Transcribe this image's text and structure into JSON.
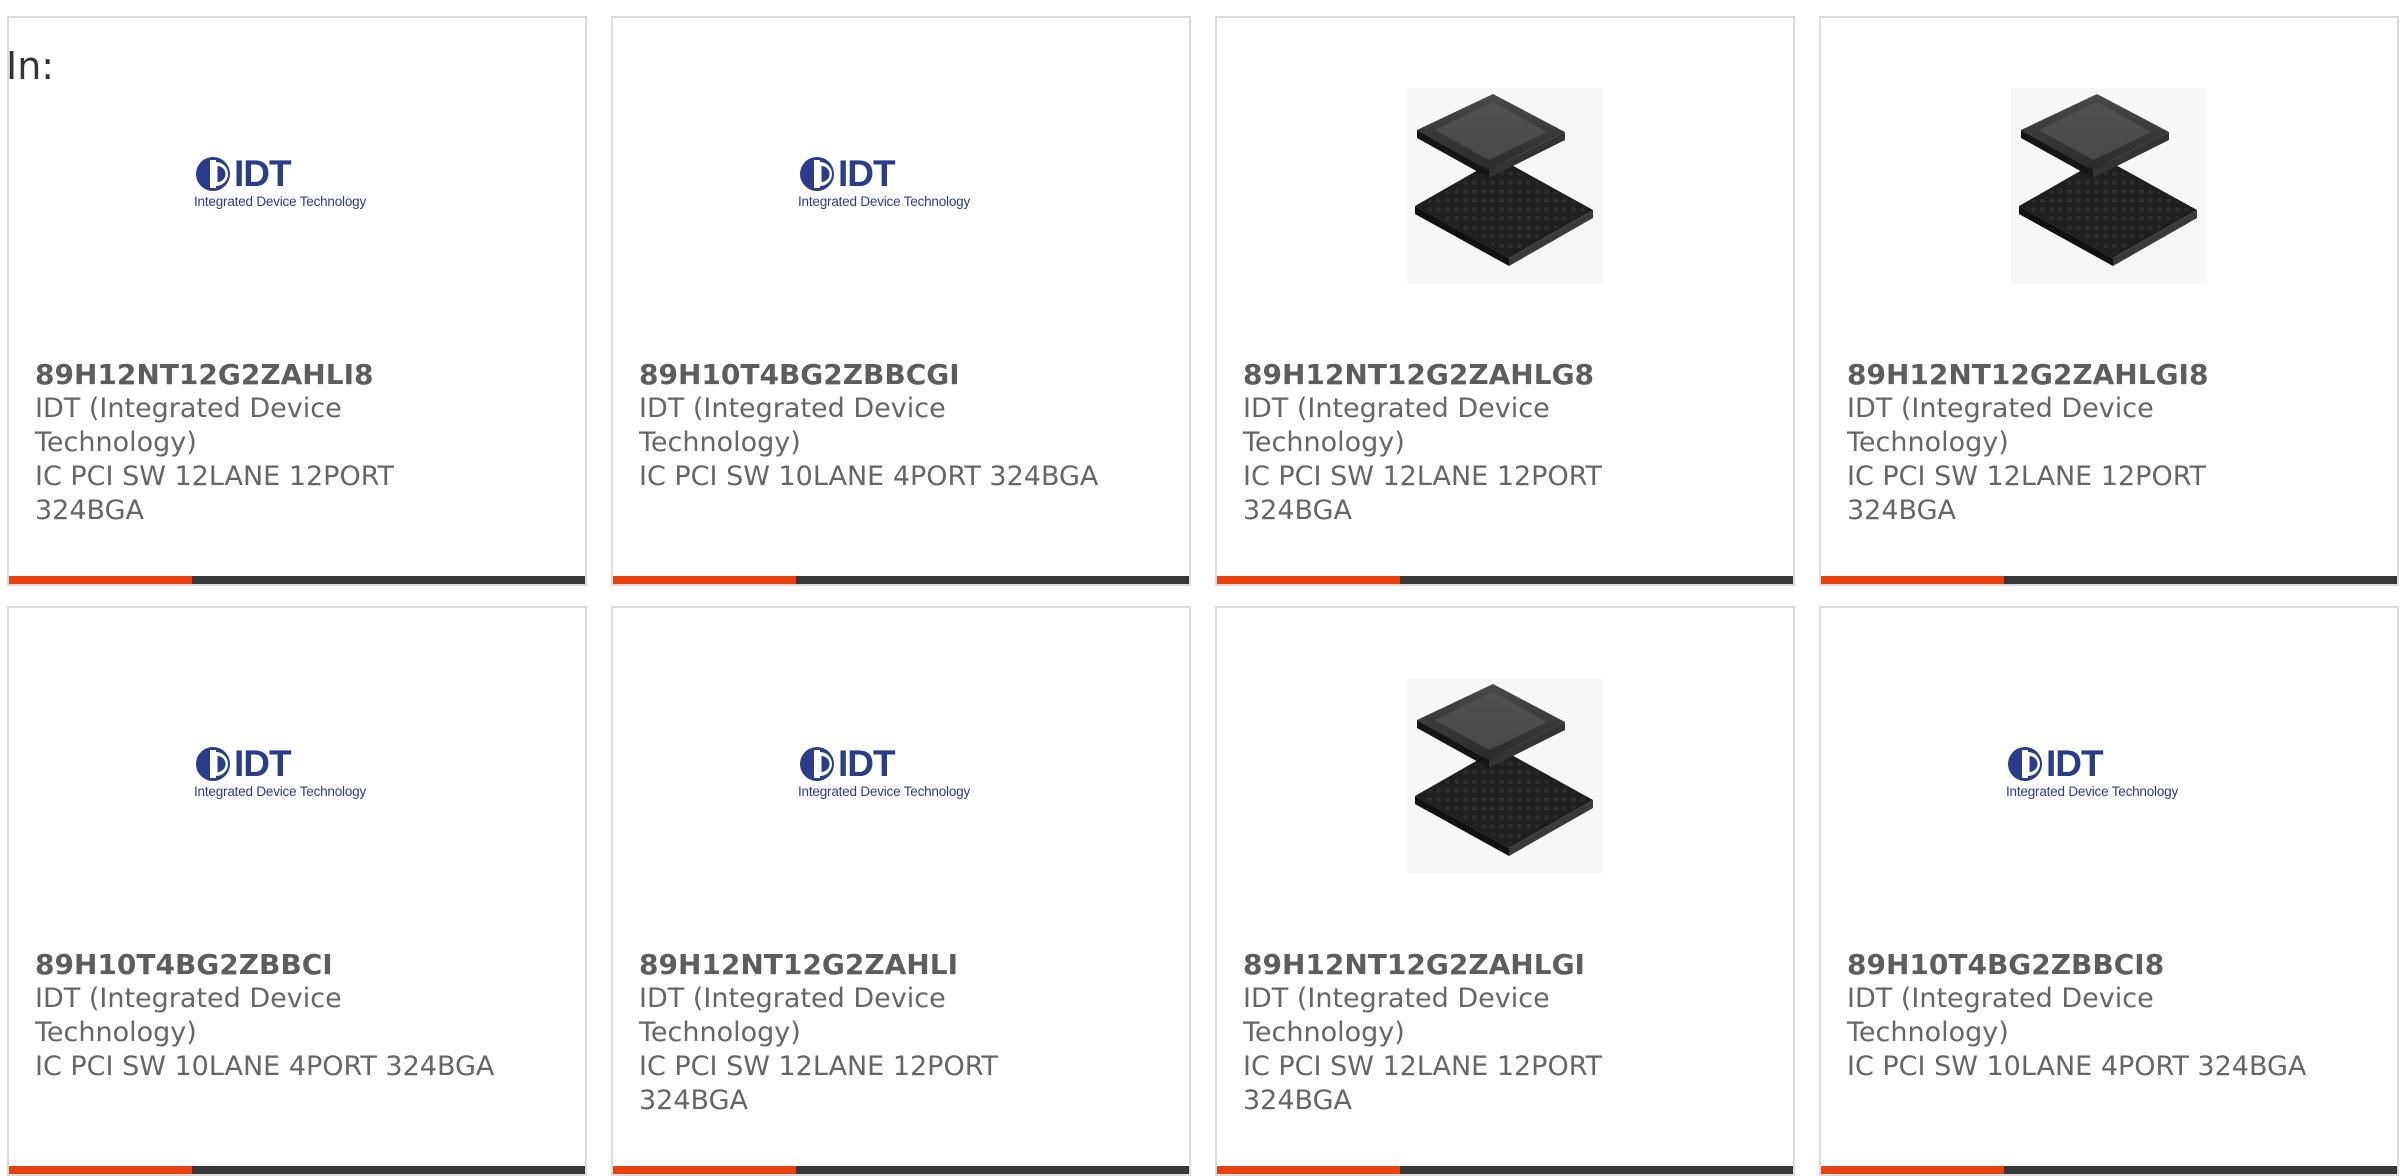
{
  "filter": {
    "label": "In:"
  },
  "colors": {
    "accent": "#e8410e",
    "bar": "#383838",
    "card_border": "#dcdcdc",
    "brand_blue": "#2a3c8c"
  },
  "products": [
    {
      "part_number": "89H12NT12G2ZAHLI8",
      "manufacturer": "IDT (Integrated Device Technology)",
      "description": "IC PCI SW 12LANE 12PORT 324BGA",
      "image": "idt-logo",
      "logo_word": "IDT",
      "logo_sub": "Integrated Device Technology"
    },
    {
      "part_number": "89H10T4BG2ZBBCGI",
      "manufacturer": "IDT (Integrated Device Technology)",
      "description": "IC PCI SW 10LANE 4PORT 324BGA",
      "image": "idt-logo",
      "logo_word": "IDT",
      "logo_sub": "Integrated Device Technology"
    },
    {
      "part_number": "89H12NT12G2ZAHLG8",
      "manufacturer": "IDT (Integrated Device Technology)",
      "description": "IC PCI SW 12LANE 12PORT 324BGA",
      "image": "bga-chip"
    },
    {
      "part_number": "89H12NT12G2ZAHLGI8",
      "manufacturer": "IDT (Integrated Device Technology)",
      "description": "IC PCI SW 12LANE 12PORT 324BGA",
      "image": "bga-chip"
    },
    {
      "part_number": "89H10T4BG2ZBBCI",
      "manufacturer": "IDT (Integrated Device Technology)",
      "description": "IC PCI SW 10LANE 4PORT 324BGA",
      "image": "idt-logo",
      "logo_word": "IDT",
      "logo_sub": "Integrated Device Technology"
    },
    {
      "part_number": "89H12NT12G2ZAHLI",
      "manufacturer": "IDT (Integrated Device Technology)",
      "description": "IC PCI SW 12LANE 12PORT 324BGA",
      "image": "idt-logo",
      "logo_word": "IDT",
      "logo_sub": "Integrated Device Technology"
    },
    {
      "part_number": "89H12NT12G2ZAHLGI",
      "manufacturer": "IDT (Integrated Device Technology)",
      "description": "IC PCI SW 12LANE 12PORT 324BGA",
      "image": "bga-chip"
    },
    {
      "part_number": "89H10T4BG2ZBBCI8",
      "manufacturer": "IDT (Integrated Device Technology)",
      "description": "IC PCI SW 10LANE 4PORT 324BGA",
      "image": "idt-logo",
      "logo_word": "IDT",
      "logo_sub": "Integrated Device Technology"
    }
  ]
}
